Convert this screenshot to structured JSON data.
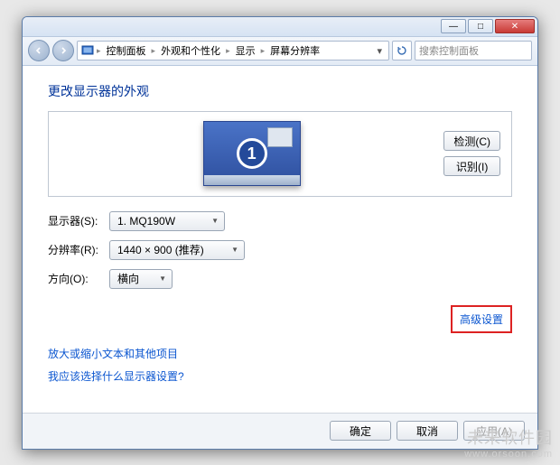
{
  "titlebar": {
    "minimize": "—",
    "maximize": "□",
    "close": "✕"
  },
  "breadcrumb": {
    "items": [
      "控制面板",
      "外观和个性化",
      "显示",
      "屏幕分辨率"
    ],
    "refresh": "↻"
  },
  "search": {
    "placeholder": "搜索控制面板"
  },
  "page": {
    "title": "更改显示器的外观"
  },
  "monitor": {
    "number": "1"
  },
  "panel_buttons": {
    "detect": "检测(C)",
    "identify": "识别(I)"
  },
  "form": {
    "display_label": "显示器(S):",
    "display_value": "1. MQ190W",
    "resolution_label": "分辨率(R):",
    "resolution_value": "1440 × 900 (推荐)",
    "orientation_label": "方向(O):",
    "orientation_value": "横向"
  },
  "advanced_link": "高级设置",
  "links": {
    "text_size": "放大或缩小文本和其他项目",
    "which_settings": "我应该选择什么显示器设置?"
  },
  "footer": {
    "ok": "确定",
    "cancel": "取消",
    "apply": "应用(A)"
  },
  "watermark": {
    "main": "未来软件园",
    "sub": "www.orsoon.com"
  }
}
